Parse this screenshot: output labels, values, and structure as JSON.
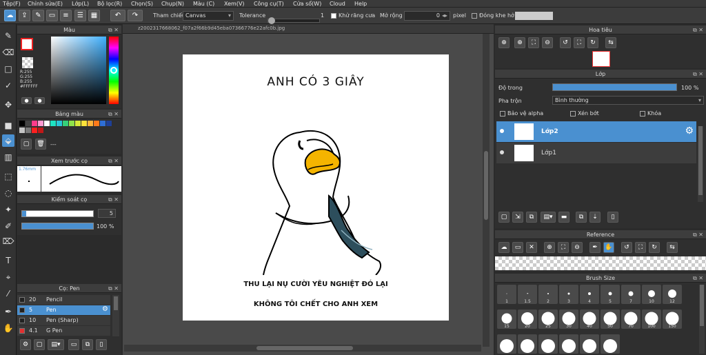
{
  "menu": [
    "Tệp(F)",
    "Chỉnh sửa(E)",
    "Lớp(L)",
    "Bộ lọc(R)",
    "Chọn(S)",
    "Chụp(N)",
    "Màu (C)",
    "Xem(V)",
    "Công cụ(T)",
    "Cửa sổ(W)",
    "Cloud",
    "Help"
  ],
  "toolbar": {
    "ref_label": "Tham chiếu",
    "ref_value": "Canvas",
    "tolerance_label": "Tolerance",
    "tolerance_value": "1",
    "antialias_label": "Khử răng cưa",
    "expand_label": "Mở rộng",
    "expand_value": "0",
    "expand_unit": "pixel",
    "closegap_label": "Đóng khe hở"
  },
  "color_panel": {
    "title": "Màu",
    "r": "R:255",
    "g": "G:255",
    "b": "B:255",
    "hex": "#FFFFFF"
  },
  "palette_panel": {
    "title": "Bảng màu",
    "swatches": [
      "#000000",
      "#444444",
      "#ff3b8b",
      "#ff9ad1",
      "#ffffff",
      "#1ee3c3",
      "#28c6d8",
      "#35d07a",
      "#8fe24a",
      "#d7e83a",
      "#ffe23a",
      "#ffb43a",
      "#ff7a1a",
      "#2f6fd6",
      "#1e3f96",
      "#c4c4c4",
      "#7a7a7a",
      "#ff2020",
      "#c01818"
    ],
    "dash": "---"
  },
  "preview_panel": {
    "title": "Xem trước cọ",
    "size": "1.76mm"
  },
  "brushctl_panel": {
    "title": "Kiểm soát cọ",
    "size_value": "5",
    "opacity_value": "100 %"
  },
  "brushlist_panel": {
    "title": "Cọ: Pen",
    "items": [
      {
        "size": "20",
        "name": "Pencil",
        "color": "#222222"
      },
      {
        "size": "5",
        "name": "Pen",
        "color": "#222222"
      },
      {
        "size": "10",
        "name": "Pen (Sharp)",
        "color": "#222222"
      },
      {
        "size": "4.1",
        "name": "G Pen",
        "color": "#e23030"
      }
    ]
  },
  "document": {
    "tab": "z2002317668062_f07a2f66b9d45eba07366776e22afc0b.jpg",
    "drawing_title": "ANH CÓ 3 GIÂY",
    "caption_line1": "THU LẠI NỤ CƯỜI YÊU NGHIỆT ĐÓ LẠI",
    "caption_line2": "KHÔNG TÔI CHẾT CHO ANH XEM"
  },
  "navigator_panel": {
    "title": "Hoa tiêu"
  },
  "layer_panel": {
    "title": "Lớp",
    "opacity_label": "Độ trong",
    "opacity_value": "100 %",
    "blend_label": "Pha trộn",
    "blend_value": "Bình thường",
    "protect_alpha": "Bảo vệ alpha",
    "clipping": "Xén bớt",
    "lock": "Khóa",
    "layers": [
      {
        "name": "Lớp2",
        "selected": true
      },
      {
        "name": "Lớp1",
        "selected": false
      }
    ]
  },
  "reference_panel": {
    "title": "Reference"
  },
  "brushsize_panel": {
    "title": "Brush Size",
    "sizes": [
      "1",
      "1.5",
      "2",
      "3",
      "4",
      "5",
      "7",
      "10",
      "12",
      "15",
      "20",
      "25",
      "30",
      "40",
      "50",
      "70",
      "100",
      "150"
    ]
  },
  "colors": {
    "accent": "#4a90d0",
    "panel": "#2f2f2f",
    "canvas_bg": "#4a4a4a"
  }
}
